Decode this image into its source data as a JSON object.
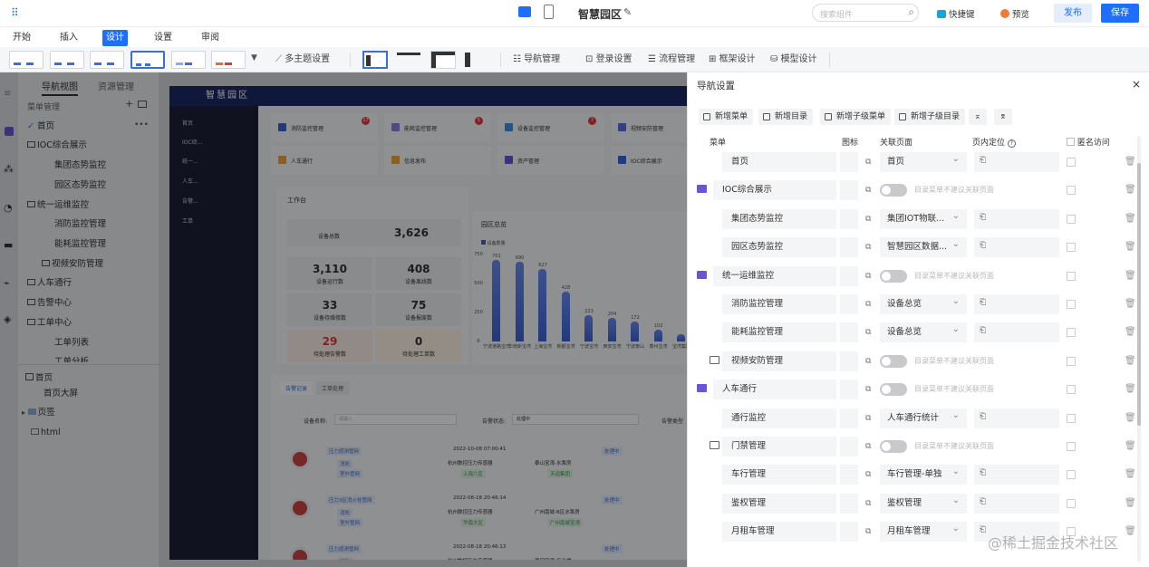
{
  "header": {
    "site_name": "智慧园区",
    "search_placeholder": "搜索组件",
    "shortcut_label": "快捷键",
    "preview_label": "预览",
    "publish_label": "发布",
    "save_label": "保存"
  },
  "menu": {
    "items": [
      "开始",
      "插入",
      "设计",
      "设置",
      "审阅"
    ],
    "active": "设计"
  },
  "toolbar": {
    "multi_theme": "多主题设置",
    "nav_manage": "导航管理",
    "login_settings": "登录设置",
    "flow_manage": "流程管理",
    "frame_design": "框架设计",
    "model_design": "模型设计"
  },
  "left_panel": {
    "tabs": [
      "导航视图",
      "资源管理"
    ],
    "section_title": "菜单管理",
    "tree": [
      "首页",
      "IOC综合展示",
      "集团态势监控",
      "园区态势监控",
      "统一运维监控",
      "消防监控管理",
      "能耗监控管理",
      "视频安防管理",
      "人车通行",
      "告警中心",
      "工单中心",
      "工单列表",
      "工单分析"
    ],
    "pages_tree": [
      "首页",
      "首页大屏",
      "页签",
      "html"
    ]
  },
  "preview": {
    "title": "智慧园区",
    "side_items": [
      "首页",
      "IOC综...",
      "统一...",
      "人车...",
      "告警...",
      "工单"
    ],
    "quick_cards": [
      {
        "label": "消防监控管理",
        "badge": "17"
      },
      {
        "label": "能耗监控管理",
        "badge": "5"
      },
      {
        "label": "设备监控管理",
        "badge": "7"
      },
      {
        "label": "视频安防管理",
        "badge": ""
      },
      {
        "label": "人车通行",
        "badge": ""
      },
      {
        "label": "信息发布",
        "badge": ""
      },
      {
        "label": "资产管理",
        "badge": ""
      },
      {
        "label": "IOC综合展示",
        "badge": ""
      }
    ],
    "workbench_title": "工作台",
    "stats": [
      {
        "value": "3,626",
        "label": "设备总数"
      },
      {
        "value": "3,110",
        "label": "设备运行数"
      },
      {
        "value": "408",
        "label": "设备离线数"
      },
      {
        "value": "33",
        "label": "设备待维修数"
      },
      {
        "value": "75",
        "label": "设备报废数"
      },
      {
        "value": "29",
        "label": "待处理告警数"
      },
      {
        "value": "0",
        "label": "待处理工单数"
      }
    ],
    "chart_title": "园区总览",
    "legend": "设备数量",
    "tabs": [
      "告警记录",
      "工单处理"
    ],
    "filter_labels": [
      "设备名称:",
      "告警状态:",
      "告警类型"
    ],
    "filter_values": [
      "请输入",
      "处理中"
    ],
    "records": [
      {
        "name": "压力感测管网",
        "time": "2022-10-08 07:00:41",
        "device": "杭州数控压力传感器",
        "location": "泰山宝湾-水泵房",
        "status": "处理中",
        "tags": [
          "消防",
          "室外管网"
        ],
        "tag2": [
          "上海六区",
          "天运集团"
        ]
      },
      {
        "name": "压力3区消火栓管网",
        "time": "2022-08-18 20:46:14",
        "device": "杭州数控压力传感器",
        "location": "广州南城-B区水泵房",
        "status": "处理中",
        "tags": [
          "消防",
          "室外管网"
        ],
        "tag2": [
          "华南大区",
          "广州南城宝湾"
        ]
      },
      {
        "name": "压力感测管网",
        "time": "2022-08-18 20:46:13",
        "device": "杭州数控压力传感器",
        "location": "西安宝湾-综合楼",
        "status": "处理中",
        "tags": [
          "消防"
        ],
        "tag2": []
      }
    ]
  },
  "chart_data": {
    "type": "bar",
    "title": "园区总览",
    "legend": [
      "设备数量"
    ],
    "ylim": [
      0,
      750
    ],
    "yticks": [
      "750",
      "500",
      "250",
      "0"
    ],
    "categories": [
      "宁波港路宝湾",
      "华南新宝湾",
      "上海宝湾",
      "新都宝湾",
      "宁波宝湾",
      "西安宝湾",
      "宁波泰山",
      "泰州宝湾",
      "宝湾集团"
    ],
    "values": [
      701,
      690,
      627,
      428,
      223,
      204,
      172,
      102,
      60
    ],
    "value_labels": [
      "701",
      "690",
      "627",
      "428",
      "223",
      "204",
      "172",
      "102",
      ""
    ]
  },
  "drawer": {
    "title": "导航设置",
    "buttons": [
      "新增菜单",
      "新增目录",
      "新增子级菜单",
      "新增子级目录"
    ],
    "columns": [
      "菜单",
      "图标",
      "关联页面",
      "页内定位",
      "匿名访问"
    ],
    "link_hint": "目录菜单不建议关联页面",
    "rows": [
      {
        "name": "首页",
        "level": 1,
        "folder": "",
        "page": "首页"
      },
      {
        "name": "IOC综合展示",
        "level": 0,
        "folder": "purple",
        "page": ""
      },
      {
        "name": "集团态势监控",
        "level": 1,
        "folder": "",
        "page": "集团IOT物联..."
      },
      {
        "name": "园区态势监控",
        "level": 1,
        "folder": "",
        "page": "智慧园区数据..."
      },
      {
        "name": "统一运维监控",
        "level": 0,
        "folder": "purple",
        "page": ""
      },
      {
        "name": "消防监控管理",
        "level": 1,
        "folder": "",
        "page": "设备总览"
      },
      {
        "name": "能耗监控管理",
        "level": 1,
        "folder": "",
        "page": "设备总览"
      },
      {
        "name": "视频安防管理",
        "level": 1,
        "folder": "outline",
        "page": ""
      },
      {
        "name": "人车通行",
        "level": 0,
        "folder": "purple",
        "page": ""
      },
      {
        "name": "通行监控",
        "level": 1,
        "folder": "",
        "page": "人车通行统计"
      },
      {
        "name": "门禁管理",
        "level": 1,
        "folder": "outline",
        "page": ""
      },
      {
        "name": "车行管理",
        "level": 1,
        "folder": "",
        "page": "车行管理-单独"
      },
      {
        "name": "鉴权管理",
        "level": 1,
        "folder": "",
        "page": "鉴权管理"
      },
      {
        "name": "月租车管理",
        "level": 1,
        "folder": "",
        "page": "月租车管理"
      }
    ]
  },
  "watermark": "@稀土掘金技术社区"
}
